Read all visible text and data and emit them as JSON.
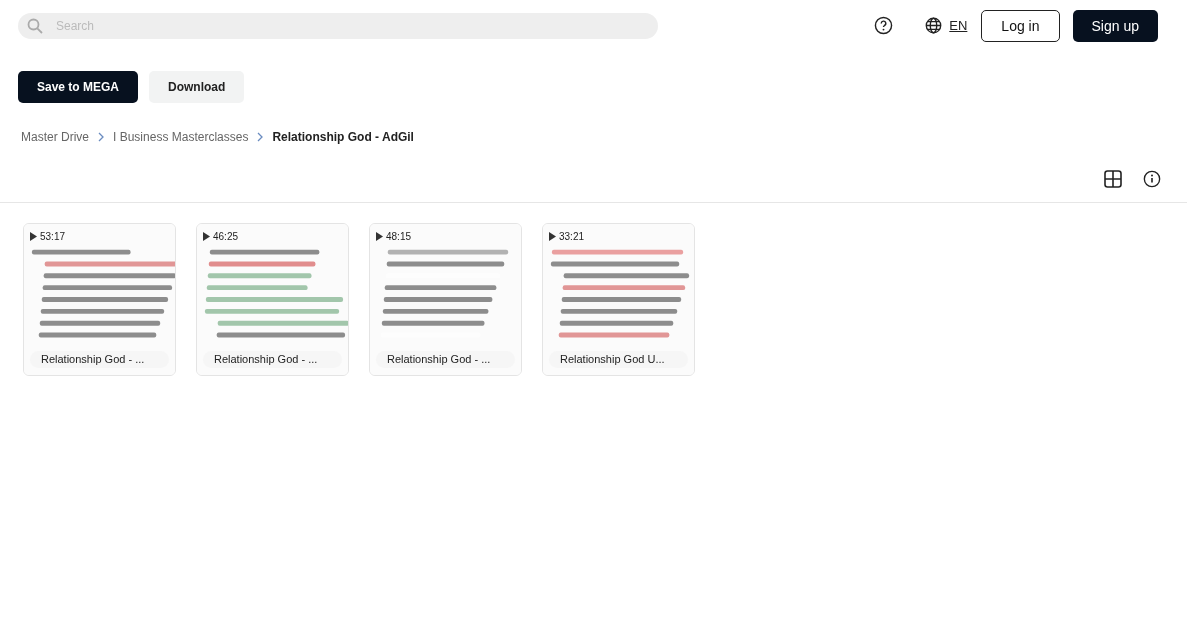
{
  "search": {
    "placeholder": "Search"
  },
  "header": {
    "language": "EN",
    "login": "Log in",
    "signup": "Sign up"
  },
  "actions": [
    "Save to MEGA",
    "Download"
  ],
  "breadcrumb": [
    {
      "label": "Master Drive",
      "current": false
    },
    {
      "label": "I Business Masterclasses",
      "current": false
    },
    {
      "label": "Relationship God - AdGil",
      "current": true
    }
  ],
  "files": [
    {
      "duration": "53:17",
      "name": "Relationship God - ..."
    },
    {
      "duration": "46:25",
      "name": "Relationship God - ..."
    },
    {
      "duration": "48:15",
      "name": "Relationship God - ..."
    },
    {
      "duration": "33:21",
      "name": "Relationship God U..."
    }
  ]
}
